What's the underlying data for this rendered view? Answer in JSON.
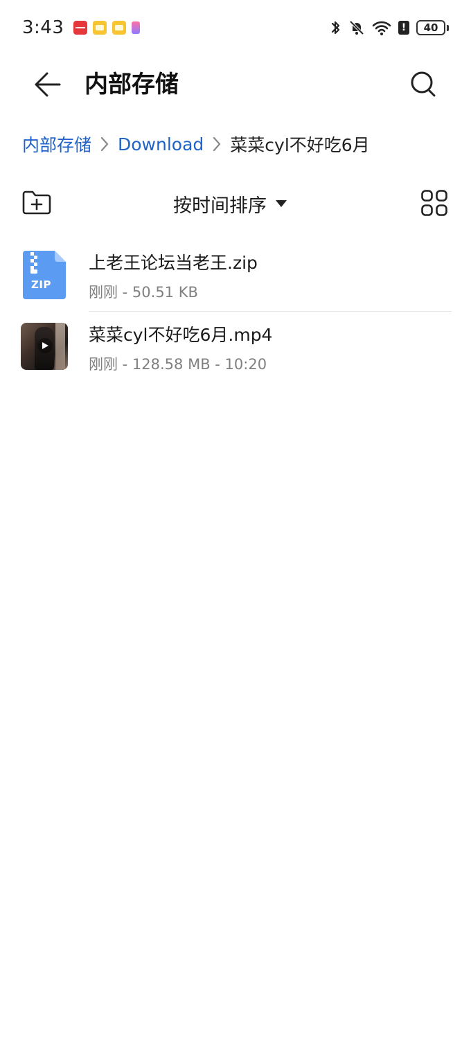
{
  "status_bar": {
    "time": "3:43",
    "battery": "40",
    "icons": [
      "huawei-app-icon",
      "folder-notification-icon",
      "folder-notification-icon",
      "app-notification-icon",
      "bluetooth-icon",
      "mute-icon",
      "wifi-icon",
      "alert-icon",
      "battery-icon"
    ]
  },
  "header": {
    "title": "内部存储",
    "back_icon": "back-arrow-icon",
    "search_icon": "search-icon"
  },
  "breadcrumb": {
    "items": [
      "内部存储",
      "Download",
      "菜菜cyl不好吃6月"
    ]
  },
  "toolbar": {
    "sort_label": "按时间排序",
    "new_folder_icon": "new-folder-icon",
    "grid_view_icon": "grid-view-icon"
  },
  "files": [
    {
      "name": "上老王论坛当老王.zip",
      "meta": "刚刚 - 50.51 KB",
      "type_label": "ZIP",
      "icon": "zip-file-icon"
    },
    {
      "name": "菜菜cyl不好吃6月.mp4",
      "meta": "刚刚 - 128.58 MB - 10:20",
      "icon": "video-thumbnail"
    }
  ],
  "colors": {
    "accent": "#1f63c9",
    "zip_icon": "#5b9cf2",
    "secondary_text": "#808080"
  }
}
